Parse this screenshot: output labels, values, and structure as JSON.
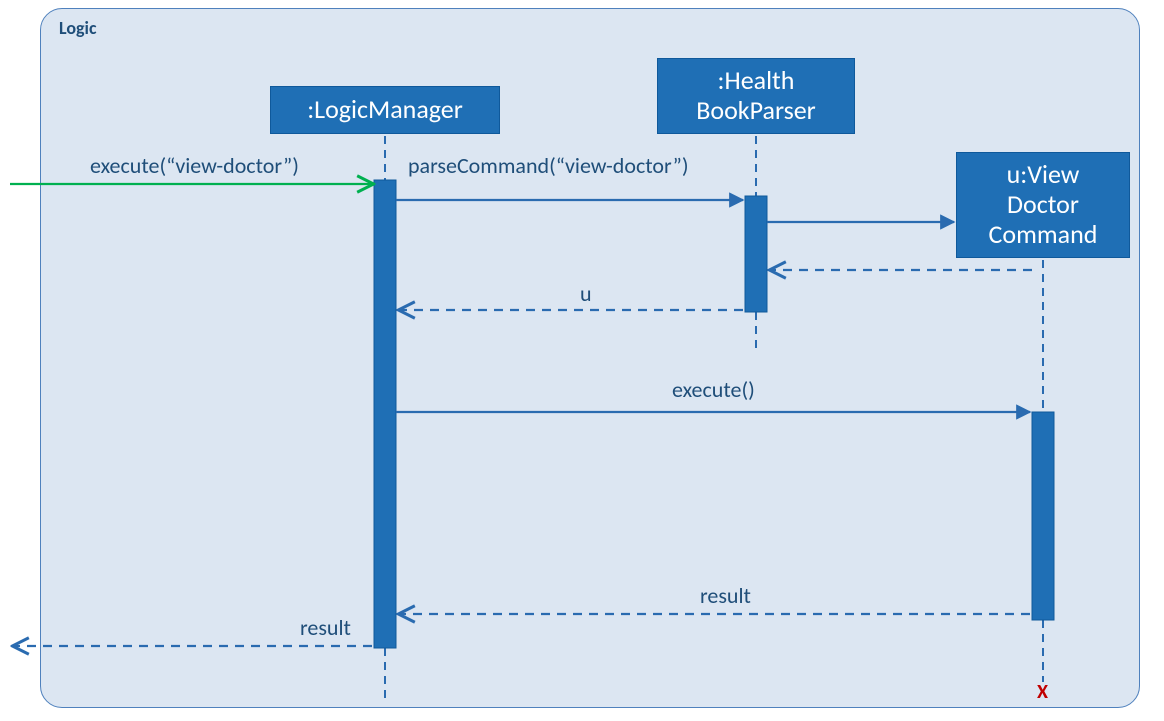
{
  "frame": {
    "label": "Logic"
  },
  "participants": {
    "logicManager": ":LogicManager",
    "healthBookParser": ":Health\nBookParser",
    "viewDoctorCommand": "u:View\nDoctor\nCommand"
  },
  "messages": {
    "execute_in": "execute(“view-doctor”)",
    "parseCommand": "parseCommand(“view-doctor”)",
    "return_u": "u",
    "execute_call": "execute()",
    "return_result_inner": "result",
    "return_result_outer": "result"
  },
  "destroy_mark": "X"
}
